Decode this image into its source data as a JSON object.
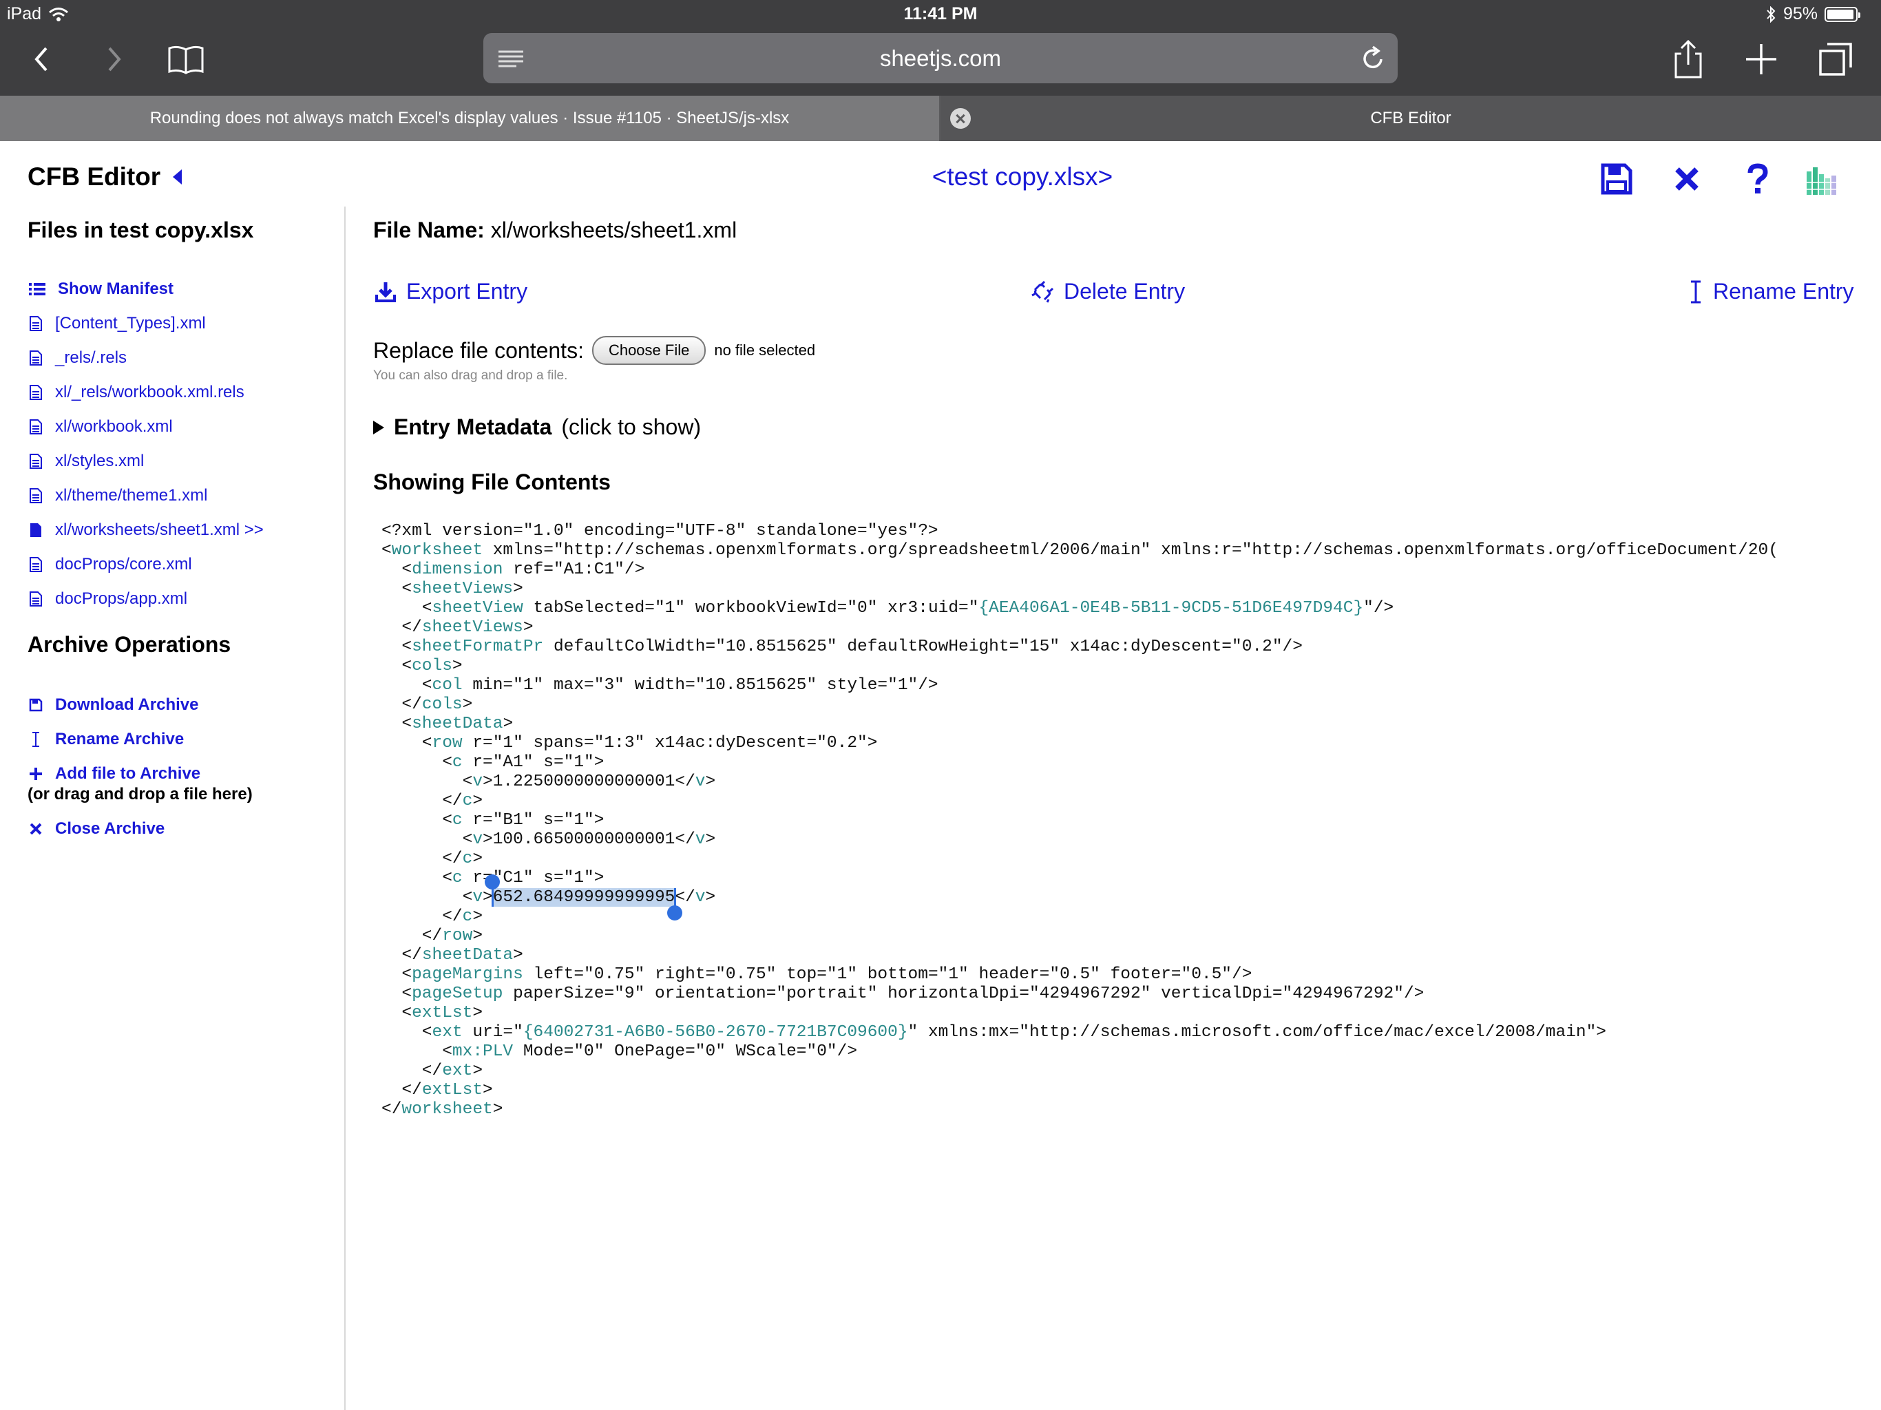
{
  "status_bar": {
    "device": "iPad",
    "time": "11:41 PM",
    "battery_percent": "95%",
    "battery_level": 0.95
  },
  "browser": {
    "url": "sheetjs.com"
  },
  "tabs": [
    {
      "title": "Rounding does not always match Excel's display values · Issue #1105 · SheetJS/js-xlsx"
    },
    {
      "title": "CFB Editor"
    }
  ],
  "app": {
    "title": "CFB Editor",
    "file_title": "<test copy.xlsx>"
  },
  "sidebar": {
    "files_heading": "Files in test copy.xlsx",
    "files": [
      {
        "label": "Show Manifest",
        "icon": "list-icon"
      },
      {
        "label": "[Content_Types].xml",
        "icon": "document-icon"
      },
      {
        "label": "_rels/.rels",
        "icon": "document-icon"
      },
      {
        "label": "xl/_rels/workbook.xml.rels",
        "icon": "document-icon"
      },
      {
        "label": "xl/workbook.xml",
        "icon": "document-icon"
      },
      {
        "label": "xl/styles.xml",
        "icon": "document-icon"
      },
      {
        "label": "xl/theme/theme1.xml",
        "icon": "document-icon"
      },
      {
        "label": "xl/worksheets/sheet1.xml >>",
        "icon": "document-filled-icon"
      },
      {
        "label": "docProps/core.xml",
        "icon": "document-icon"
      },
      {
        "label": "docProps/app.xml",
        "icon": "document-icon"
      }
    ],
    "archive_heading": "Archive Operations",
    "operations": [
      {
        "label": "Download Archive",
        "icon": "save-icon"
      },
      {
        "label": "Rename Archive",
        "icon": "text-cursor-icon"
      },
      {
        "label": "Add file to Archive",
        "icon": "plus-icon"
      },
      {
        "label": "Close Archive",
        "icon": "close-icon"
      }
    ],
    "drag_note": "(or drag and drop a file here)"
  },
  "main": {
    "file_name_label": "File Name:",
    "file_name": "xl/worksheets/sheet1.xml",
    "actions": {
      "export": "Export Entry",
      "delete": "Delete Entry",
      "rename": "Rename Entry"
    },
    "replace_label": "Replace file contents:",
    "choose_file": "Choose File",
    "no_file": "no file selected",
    "drag_hint": "You can also drag and drop a file.",
    "metadata_bold": "Entry Metadata",
    "metadata_hint": "(click to show)",
    "showing_heading": "Showing File Contents",
    "selected_text": "652.68499999999995"
  },
  "colors": {
    "link": "#1a1ad6",
    "chrome": "#3e3e40",
    "tag": "#2a8a8a",
    "selection": "#bfd4ee",
    "handle": "#2f6fde"
  }
}
